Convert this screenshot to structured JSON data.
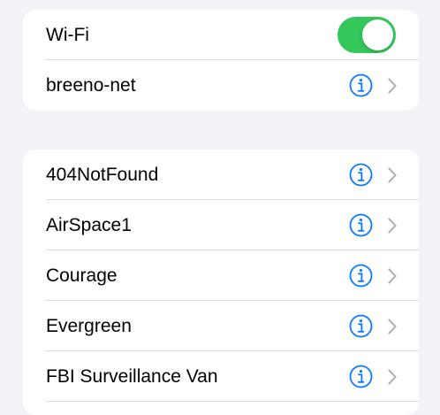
{
  "colors": {
    "accent": "#0a7aff",
    "toggle_on": "#34c759",
    "chevron": "#b4b4b8"
  },
  "wifi_section": {
    "wifi_label": "Wi-Fi",
    "wifi_enabled": true,
    "connected_network": "breeno-net"
  },
  "networks": [
    {
      "name": "404NotFound"
    },
    {
      "name": "AirSpace1"
    },
    {
      "name": "Courage"
    },
    {
      "name": "Evergreen"
    },
    {
      "name": "FBI Surveillance Van"
    }
  ],
  "icons": {
    "info": "info-circle-icon",
    "chevron": "chevron-right-icon"
  }
}
